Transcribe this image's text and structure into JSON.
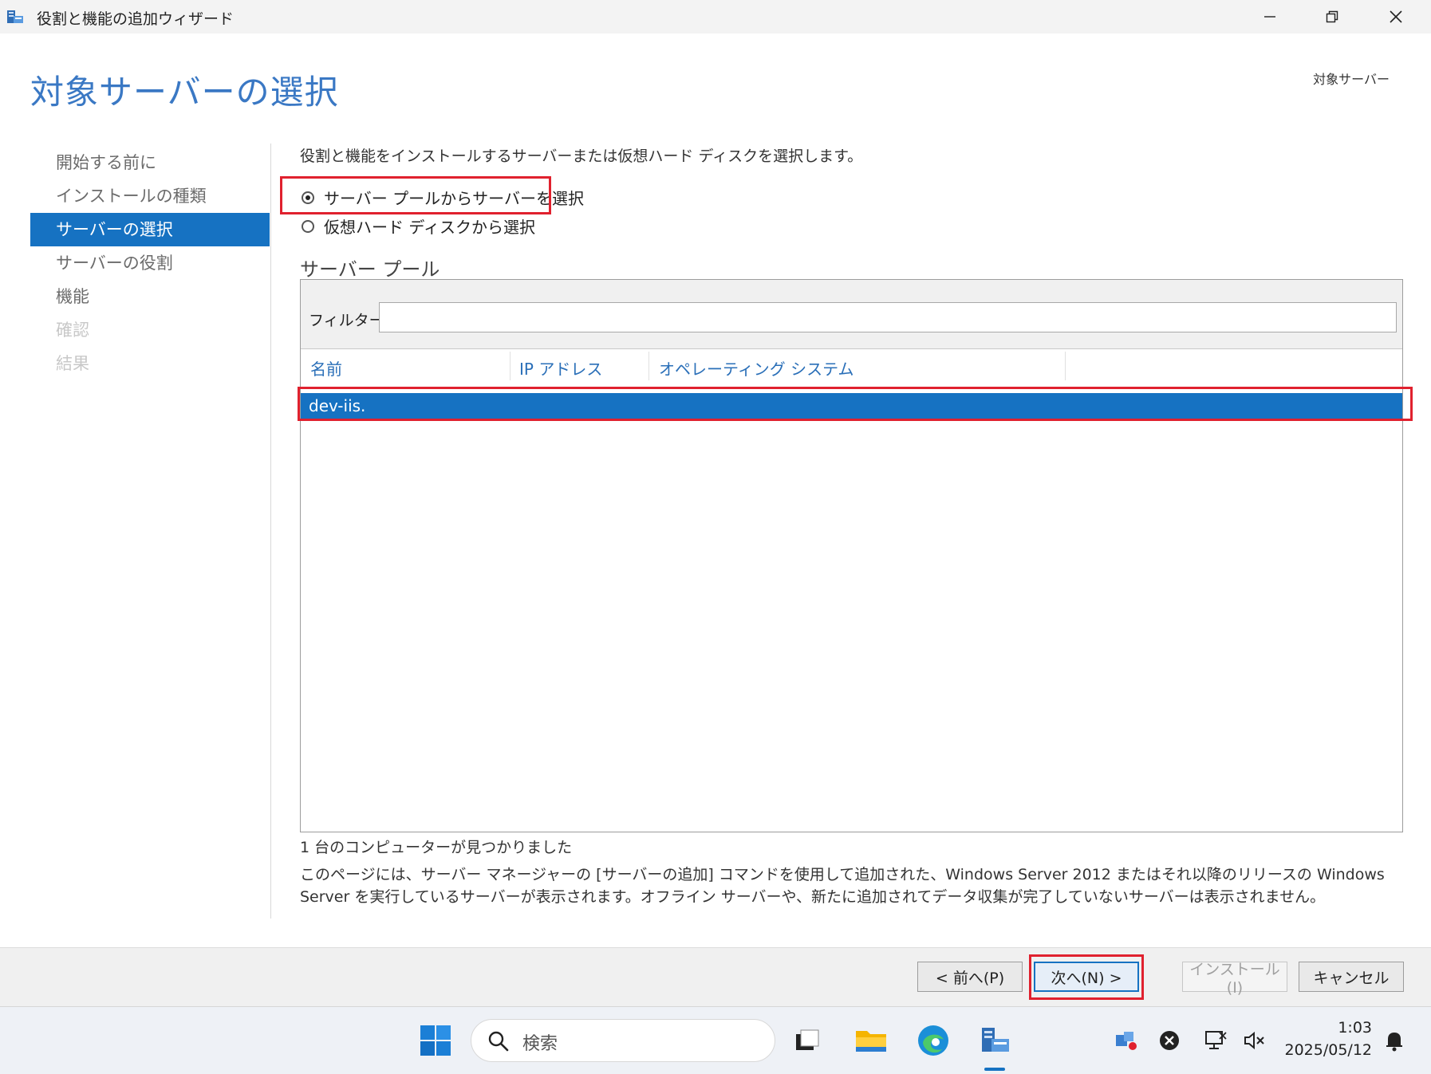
{
  "window": {
    "title": "役割と機能の追加ウィザード"
  },
  "page": {
    "title": "対象サーバーの選択",
    "destination_label": "対象サーバー",
    "description": "役割と機能をインストールするサーバーまたは仮想ハード ディスクを選択します。"
  },
  "nav": {
    "items": [
      {
        "label": "開始する前に",
        "state": "normal"
      },
      {
        "label": "インストールの種類",
        "state": "normal"
      },
      {
        "label": "サーバーの選択",
        "state": "active"
      },
      {
        "label": "サーバーの役割",
        "state": "normal"
      },
      {
        "label": "機能",
        "state": "normal"
      },
      {
        "label": "確認",
        "state": "disabled"
      },
      {
        "label": "結果",
        "state": "disabled"
      }
    ]
  },
  "options": {
    "pool_label": "サーバー プールからサーバーを選択",
    "vhd_label": "仮想ハード ディスクから選択",
    "selected": "pool"
  },
  "server_pool": {
    "label": "サーバー プール",
    "filter_label": "フィルター:",
    "filter_value": "",
    "columns": [
      "名前",
      "IP アドレス",
      "オペレーティング システム"
    ],
    "rows": [
      {
        "name": "dev-iis.",
        "ip": "",
        "os": ""
      }
    ]
  },
  "footer": {
    "found": "1 台のコンピューターが見つかりました",
    "notice": "このページには、サーバー マネージャーの [サーバーの追加] コマンドを使用して追加された、Windows Server 2012 またはそれ以降のリリースの Windows Server を実行しているサーバーが表示されます。オフライン サーバーや、新たに追加されてデータ収集が完了していないサーバーは表示されません。"
  },
  "buttons": {
    "prev": "< 前へ(P)",
    "next": "次へ(N) >",
    "install": "インストール(I)",
    "cancel": "キャンセル"
  },
  "taskbar": {
    "search_placeholder": "検索",
    "time": "1:03",
    "date": "2025/05/12"
  },
  "colors": {
    "accent": "#1672c2",
    "title_blue": "#3a78c4",
    "highlight_red": "#e0212e"
  }
}
